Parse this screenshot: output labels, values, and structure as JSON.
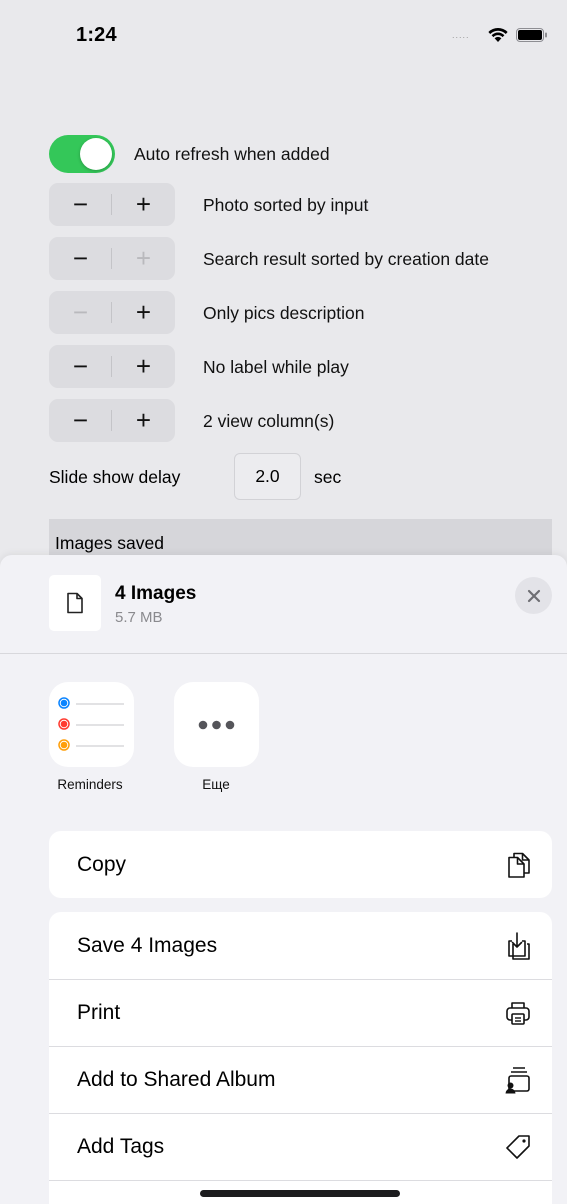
{
  "status_bar": {
    "time": "1:24",
    "signal": "....."
  },
  "settings": {
    "auto_refresh_label": "Auto refresh when added",
    "steppers": [
      {
        "label": "Photo sorted by input",
        "minus_enabled": true,
        "plus_enabled": true
      },
      {
        "label": "Search result sorted by creation date",
        "minus_enabled": true,
        "plus_enabled": false
      },
      {
        "label": "Only pics description",
        "minus_enabled": false,
        "plus_enabled": true
      },
      {
        "label": "No label while play",
        "minus_enabled": true,
        "plus_enabled": true
      },
      {
        "label": "2 view column(s)",
        "minus_enabled": true,
        "plus_enabled": true
      }
    ],
    "minus_symbol": "−",
    "plus_symbol": "+",
    "slide_show_label": "Slide show delay",
    "slide_show_value": "2.0",
    "slide_show_unit": "sec",
    "images_saved": "Images saved"
  },
  "share_sheet": {
    "title": "4 Images",
    "subtitle": "5.7 MB",
    "apps": [
      {
        "label": "Reminders",
        "icon": "reminders-icon"
      },
      {
        "label": "Еще",
        "icon": "more-icon"
      }
    ],
    "actions_group1": [
      {
        "label": "Copy",
        "icon": "copy-icon"
      }
    ],
    "actions_group2": [
      {
        "label": "Save 4 Images",
        "icon": "save-icon"
      },
      {
        "label": "Print",
        "icon": "print-icon"
      },
      {
        "label": "Add to Shared Album",
        "icon": "shared-album-icon"
      },
      {
        "label": "Add Tags",
        "icon": "tag-icon"
      }
    ]
  },
  "colors": {
    "toggle_on": "#34c759",
    "reminder_blue": "#0a84ff",
    "reminder_red": "#ff3b30",
    "reminder_orange": "#ff9f0a"
  }
}
